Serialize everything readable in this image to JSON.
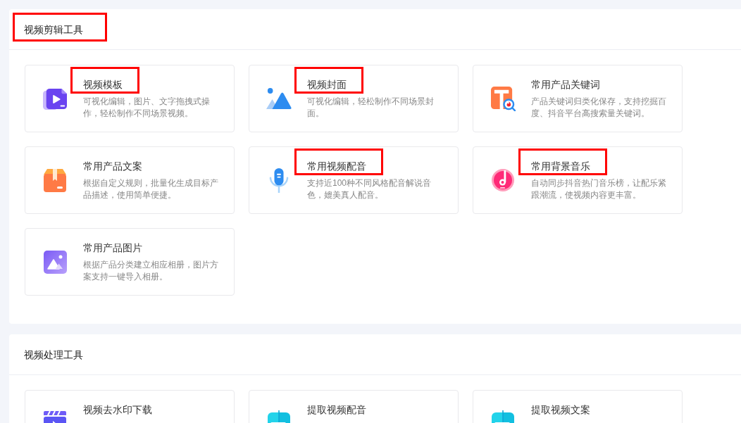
{
  "sections": [
    {
      "title": "视频剪辑工具",
      "highlighted": true,
      "cards": [
        {
          "title": "视频模板",
          "description": "可视化编辑，图片、文字拖拽式操作，轻松制作不同场景视频。",
          "highlighted": true
        },
        {
          "title": "视频封面",
          "description": "可视化编辑，轻松制作不同场景封面。",
          "highlighted": true
        },
        {
          "title": "常用产品关键词",
          "description": "产品关键词归类化保存，支持挖掘百度、抖音平台高搜索量关键词。",
          "highlighted": false
        },
        {
          "title": "常用产品文案",
          "description": "根据自定义规则，批量化生成目标产品描述，使用简单便捷。",
          "highlighted": false
        },
        {
          "title": "常用视频配音",
          "description": "支持近100种不同风格配音解说音色，媲美真人配音。",
          "highlighted": true
        },
        {
          "title": "常用背景音乐",
          "description": "自动同步抖音热门音乐榜，让配乐紧跟潮流，使视频内容更丰富。",
          "highlighted": true
        },
        {
          "title": "常用产品图片",
          "description": "根据产品分类建立相应相册，图片方案支持一键导入相册。",
          "highlighted": false
        }
      ]
    },
    {
      "title": "视频处理工具",
      "highlighted": false,
      "cards": [
        {
          "title": "视频去水印下载",
          "highlighted": false
        },
        {
          "title": "提取视频配音",
          "highlighted": false
        },
        {
          "title": "提取视频文案",
          "highlighted": false
        }
      ]
    }
  ]
}
